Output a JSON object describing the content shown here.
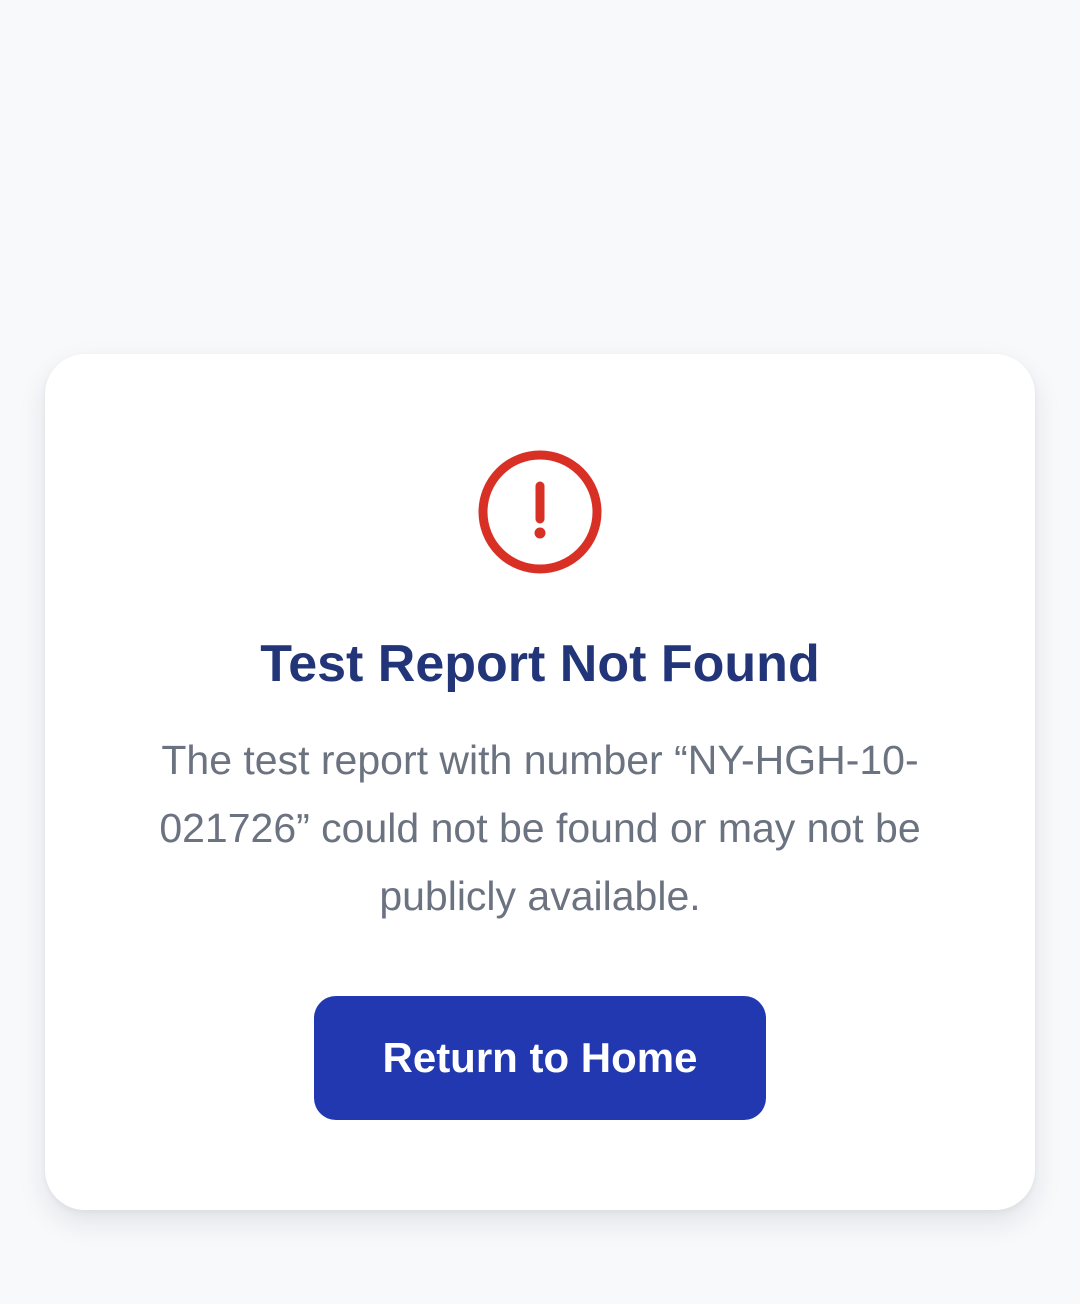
{
  "error_card": {
    "icon": "alert-circle-icon",
    "icon_color": "#d93025",
    "title": "Test Report Not Found",
    "message": "The test report with number “NY-HGH-10-021726” could not be found or may not be publicly available.",
    "button_label": "Return to Home"
  },
  "colors": {
    "title": "#233579",
    "button": "#2238b1",
    "message": "#6b7280",
    "background": "#f8f9fb"
  }
}
